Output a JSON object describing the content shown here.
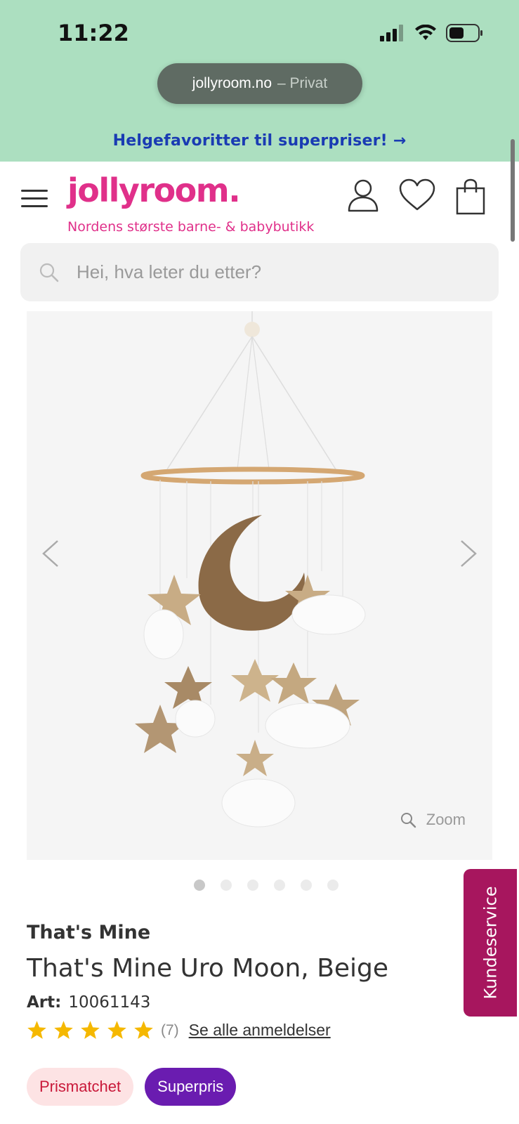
{
  "status_bar": {
    "time": "11:22"
  },
  "browser": {
    "domain": "jollyroom.no",
    "mode": "– Privat"
  },
  "promo": {
    "text": "Helgefavoritter til superpriser! →"
  },
  "header": {
    "logo": "jollyroom.",
    "tagline": "Nordens største barne- & babybutikk"
  },
  "search": {
    "placeholder": "Hei, hva leter du etter?"
  },
  "gallery": {
    "zoom_label": "Zoom",
    "image_count": 6,
    "active_index": 0
  },
  "product": {
    "brand": "That's Mine",
    "title": "That's Mine Uro Moon, Beige",
    "art_label": "Art:",
    "art_number": "10061143",
    "rating_stars": 5,
    "review_count": "(7)",
    "reviews_link": "Se alle anmeldelser"
  },
  "badges": {
    "price_matched": "Prismatchet",
    "super_price": "Superpris"
  },
  "customer_service": {
    "label": "Kundeservice"
  },
  "colors": {
    "brand_pink": "#e0308a",
    "promo_blue": "#1a3bb3",
    "kundeservice": "#a7165e",
    "superpris": "#6a1cb0",
    "star": "#f5b800"
  }
}
